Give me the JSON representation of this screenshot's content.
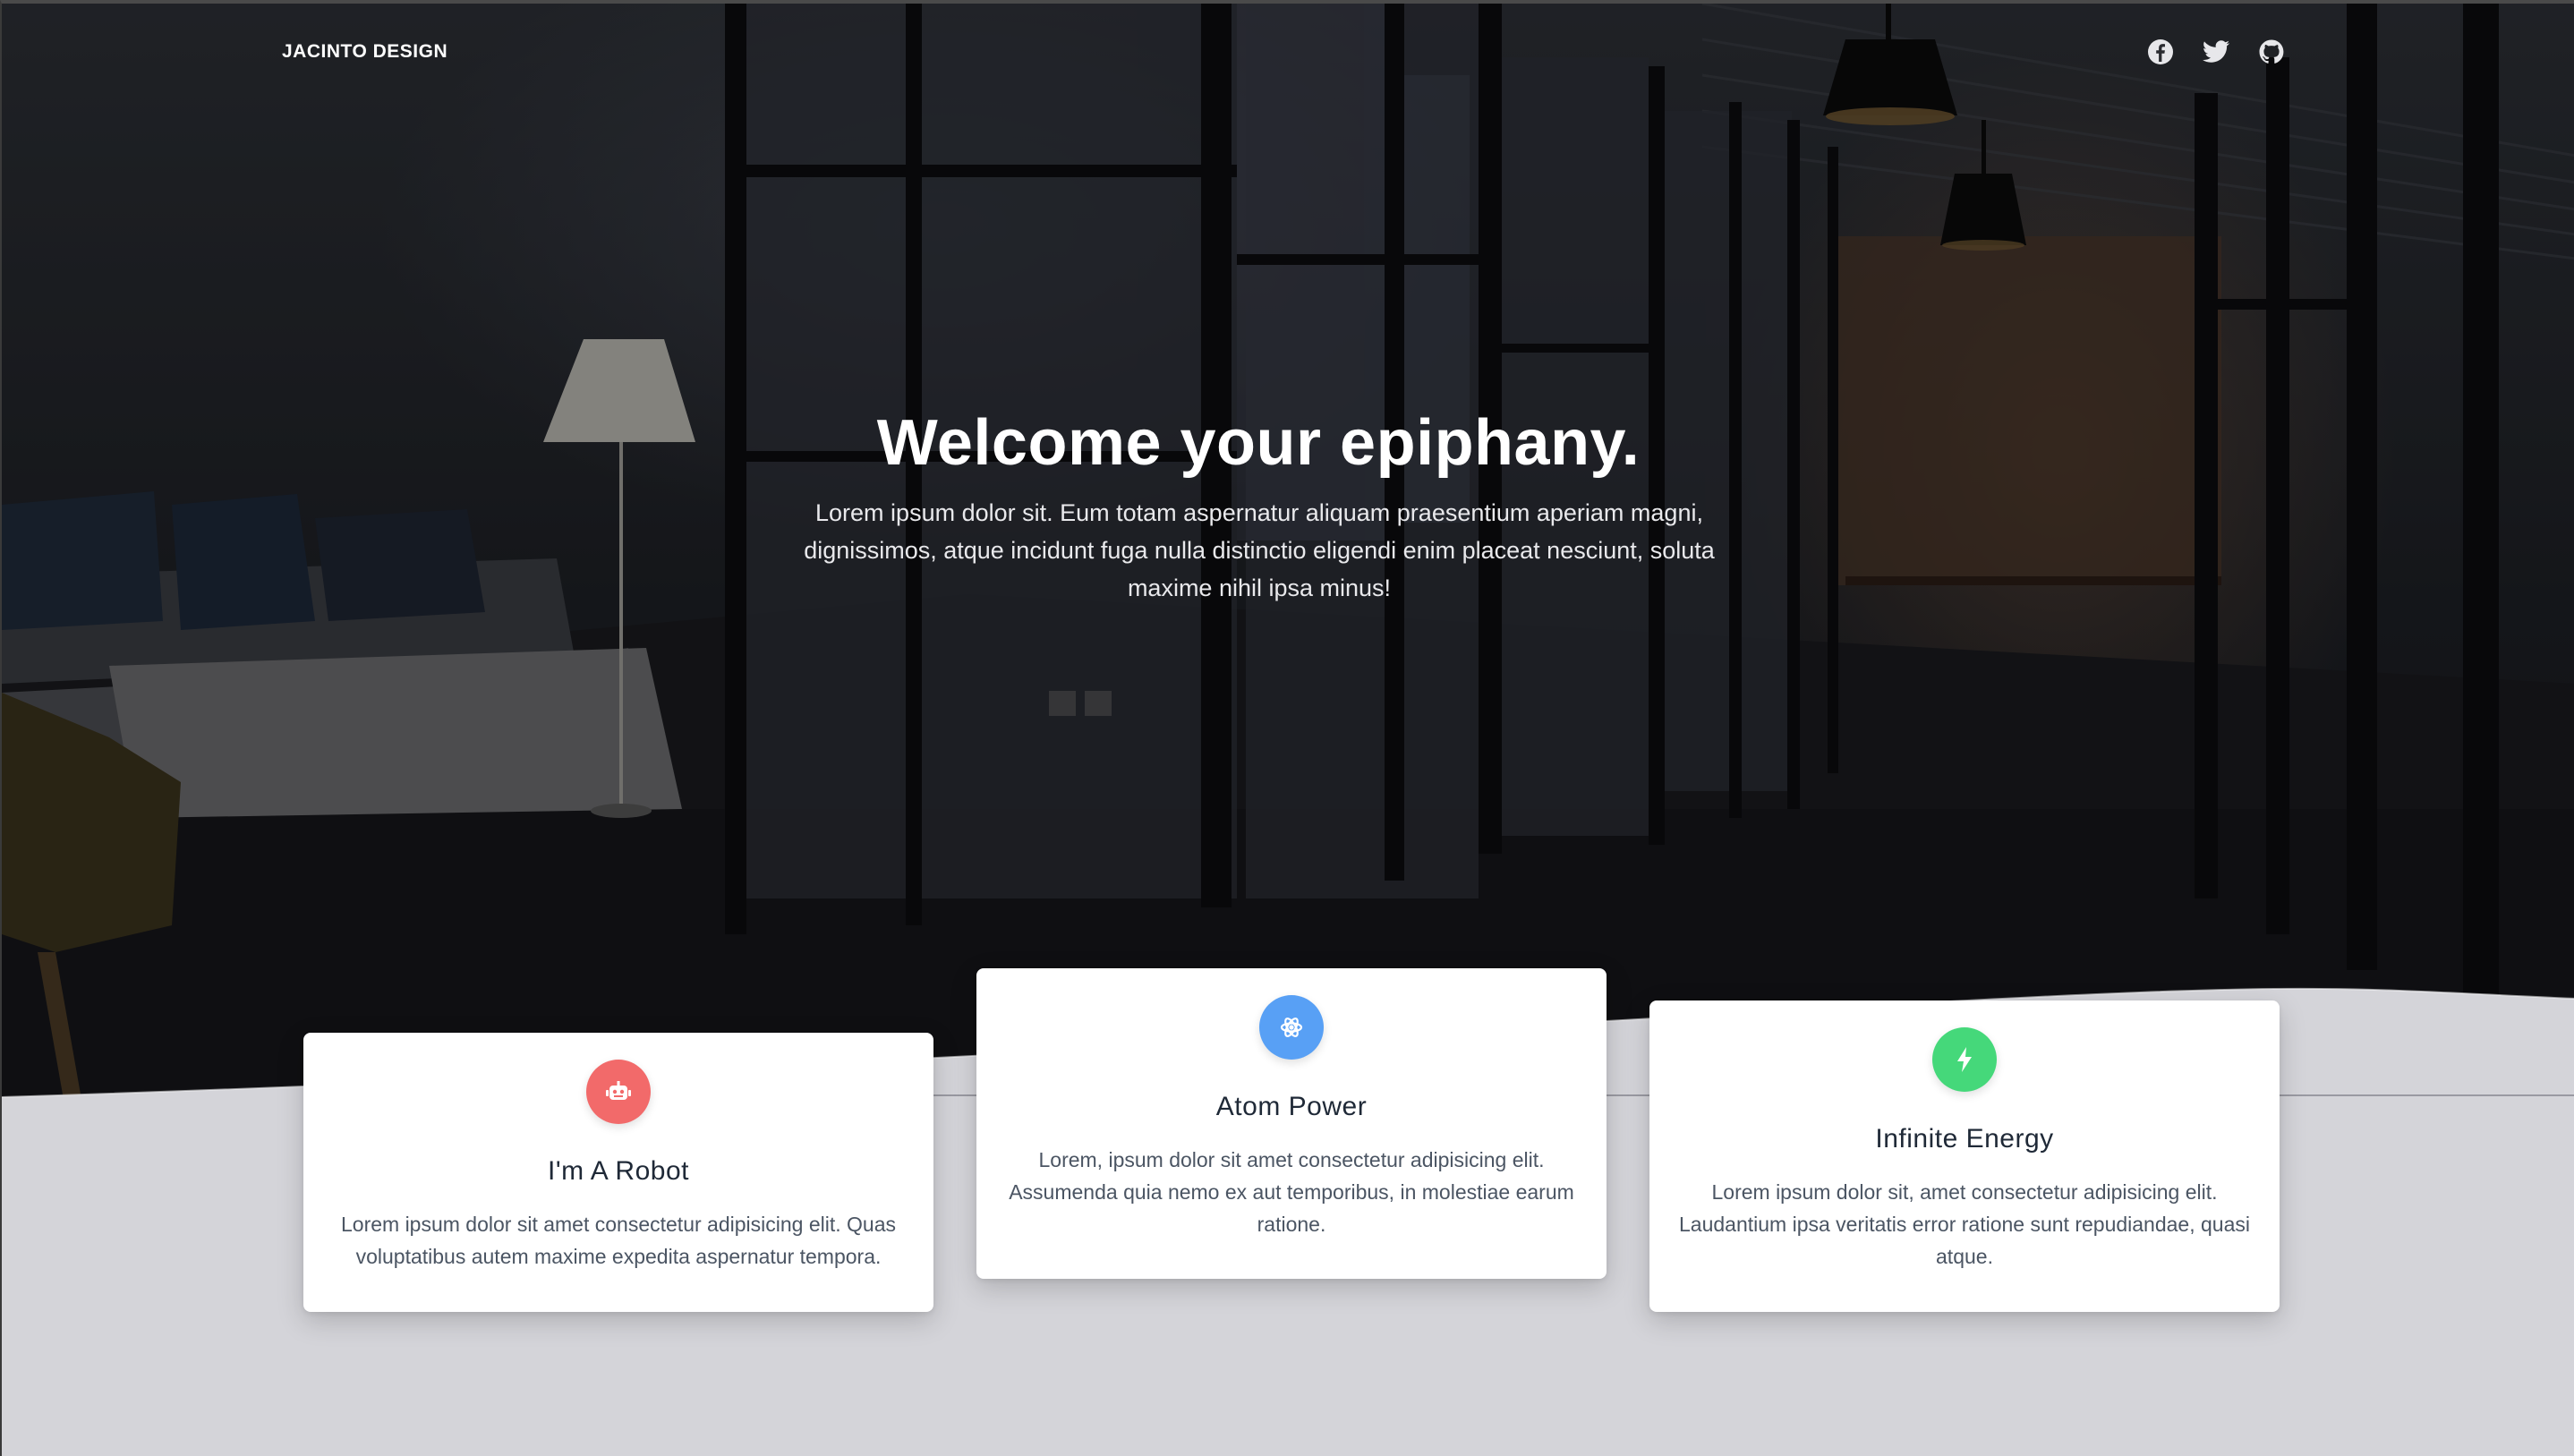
{
  "nav": {
    "brand": "JACINTO DESIGN",
    "social": [
      "facebook-icon",
      "twitter-icon",
      "github-icon"
    ]
  },
  "hero": {
    "title": "Welcome your epiphany.",
    "lead": "Lorem ipsum dolor sit. Eum totam aspernatur aliquam praesentium aperiam magni, dignissimos, atque incidunt fuga nulla distinctio eligendi enim placeat nesciunt, soluta maxime nihil ipsa minus!"
  },
  "features": [
    {
      "icon": "robot-icon",
      "color": "#f26a6a",
      "title": "I'm A Robot",
      "text": "Lorem ipsum dolor sit amet consectetur adipisicing elit. Quas voluptatibus autem maxime expedita aspernatur tempora."
    },
    {
      "icon": "atom-icon",
      "color": "#58a0f5",
      "title": "Atom Power",
      "text": "Lorem, ipsum dolor sit amet consectetur adipisicing elit. Assumenda quia nemo ex aut temporibus, in molestiae earum ratione."
    },
    {
      "icon": "lightning-icon",
      "color": "#45d87a",
      "title": "Infinite Energy",
      "text": "Lorem ipsum dolor sit, amet consectetur adipisicing elit. Laudantium ipsa veritatis error ratione sunt repudiandae, quasi atque."
    }
  ],
  "colors": {
    "background": "#d4d4d9",
    "card": "#ffffff",
    "heading": "#1f2937",
    "body": "#4b5563"
  }
}
